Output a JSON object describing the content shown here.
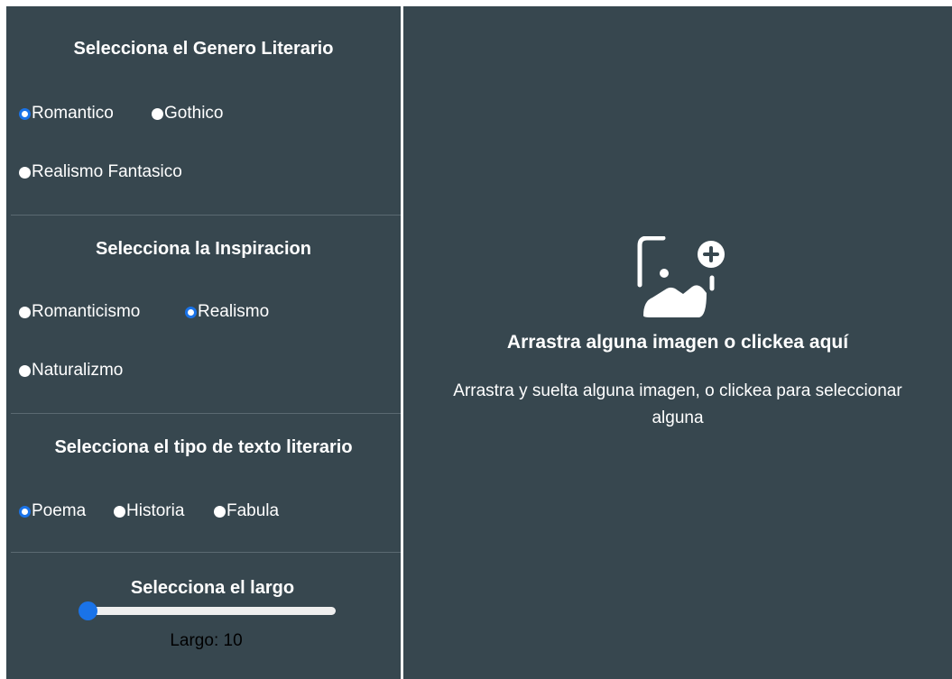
{
  "genero": {
    "title": "Selecciona el Genero Literario",
    "options": [
      "Romantico",
      "Gothico",
      "Realismo Fantasico"
    ],
    "selected": "Romantico"
  },
  "inspiracion": {
    "title": "Selecciona la Inspiracion",
    "options": [
      "Romanticismo",
      "Realismo",
      "Naturalizmo"
    ],
    "selected": "Realismo"
  },
  "tipo": {
    "title": "Selecciona el tipo de texto literario",
    "options": [
      "Poema",
      "Historia",
      "Fabula"
    ],
    "selected": "Poema"
  },
  "largo": {
    "title": "Selecciona el largo",
    "label": "Largo: 10",
    "value": 10,
    "slider_fraction": 0.0
  },
  "dropzone": {
    "title": "Arrastra alguna imagen o clickea aquí",
    "subtitle": "Arrastra y suelta alguna imagen, o clickea para seleccionar alguna",
    "icon": "image-add-icon"
  },
  "colors": {
    "panel_bg": "#37474f",
    "accent": "#1a73e8",
    "text": "#ffffff"
  }
}
